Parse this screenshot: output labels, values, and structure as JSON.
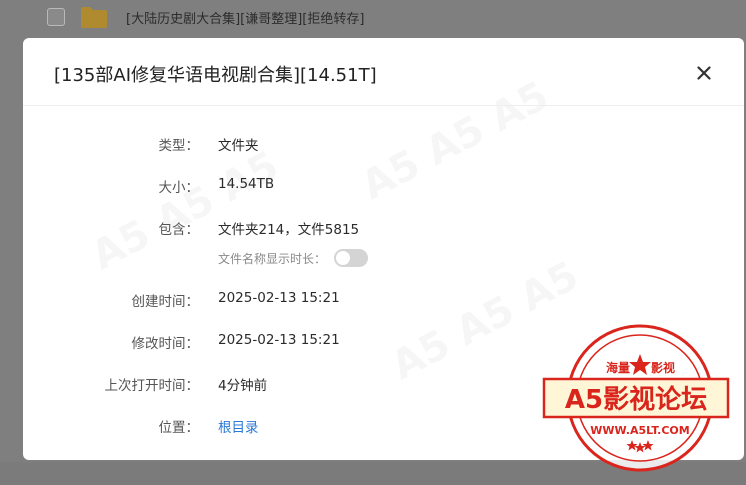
{
  "background_list": {
    "row_name": "[大陆历史剧大合集][谦哥整理][拒绝转存]"
  },
  "dialog": {
    "title": "[135部AI修复华语电视剧合集][14.51T]",
    "close_icon": "close-icon",
    "rows": {
      "type": {
        "label": "类型：",
        "value": "文件夹"
      },
      "size": {
        "label": "大小：",
        "value": "14.54TB"
      },
      "contains": {
        "label": "包含：",
        "value": "文件夹214，文件5815"
      },
      "show_duration": {
        "label": "文件名称显示时长：",
        "enabled": false
      },
      "created": {
        "label": "创建时间：",
        "value": "2025-02-13 15:21"
      },
      "modified": {
        "label": "修改时间：",
        "value": "2025-02-13 15:21"
      },
      "last_opened": {
        "label": "上次打开时间：",
        "value": "4分钟前"
      },
      "location": {
        "label": "位置：",
        "value": "根目录"
      }
    }
  },
  "stamp": {
    "top_text": "海量",
    "top_text_right": "影视",
    "main_text": "A5影视论坛",
    "url": "WWW.A5LT.COM",
    "color": "#d9251c"
  },
  "colors": {
    "link": "#2b78d6",
    "folder": "#f5c242",
    "toggle_off": "#d4d4d4"
  }
}
